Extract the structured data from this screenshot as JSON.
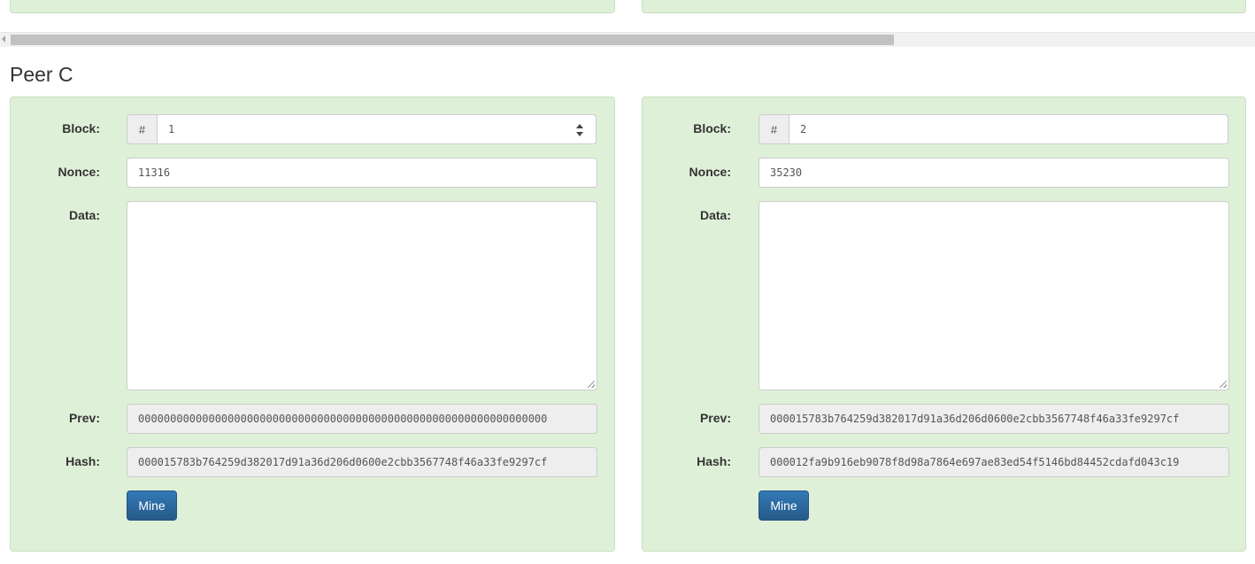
{
  "peer": {
    "title": "Peer C"
  },
  "labels": {
    "block": "Block:",
    "nonce": "Nonce:",
    "data": "Data:",
    "prev": "Prev:",
    "hash": "Hash:",
    "block_prefix": "#",
    "mine": "Mine"
  },
  "blocks": [
    {
      "number": "1",
      "nonce": "11316",
      "data": "",
      "prev": "0000000000000000000000000000000000000000000000000000000000000000",
      "hash": "000015783b764259d382017d91a36d206d0600e2cbb3567748f46a33fe9297cf"
    },
    {
      "number": "2",
      "nonce": "35230",
      "data": "",
      "prev": "000015783b764259d382017d91a36d206d0600e2cbb3567748f46a33fe9297cf",
      "hash": "000012fa9b916eb9078f8d98a7864e697ae83ed54f5146bd84452cdafd043c19"
    }
  ],
  "colors": {
    "panel_success_bg": "#dff0d8",
    "panel_border": "#c8dfbd",
    "button_primary": "#337ab7"
  }
}
